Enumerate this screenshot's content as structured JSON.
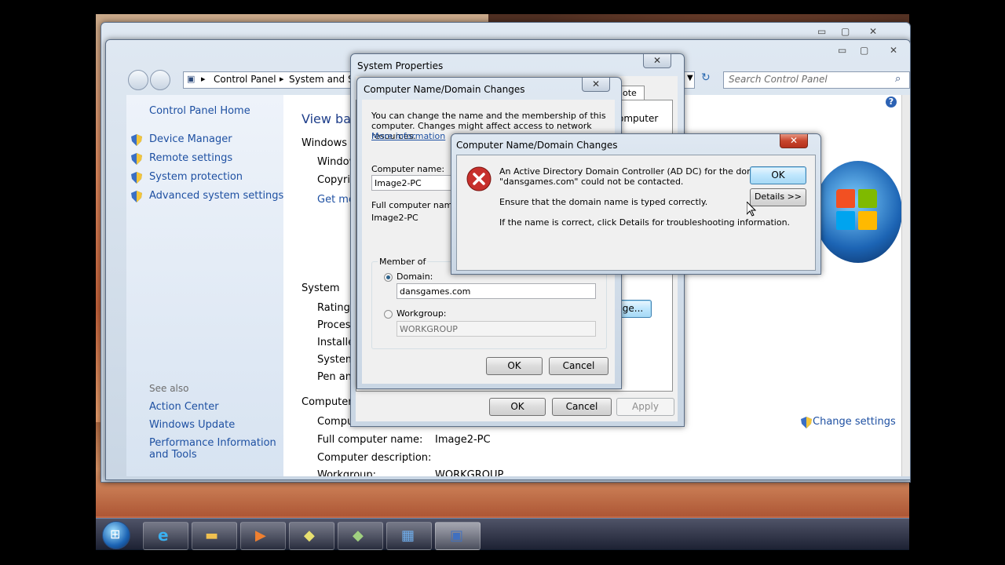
{
  "control_panel": {
    "nav": {
      "address_items": [
        "Control Panel",
        "System and Sec"
      ],
      "search_placeholder": "Search Control Panel"
    },
    "sidebar": {
      "home": "Control Panel Home",
      "items": [
        "Device Manager",
        "Remote settings",
        "System protection",
        "Advanced system settings"
      ],
      "see_also_label": "See also",
      "see_also": [
        "Action Center",
        "Windows Update",
        "Performance Information and Tools"
      ]
    },
    "main": {
      "title": "View bas",
      "windows_edition": "Windows ed",
      "edition_rows": [
        "Window",
        "Copyrig"
      ],
      "get_more": "Get mor",
      "system_label": "System",
      "system_rows": [
        "Rating:",
        "Processo",
        "Installed",
        "System t",
        "Pen and"
      ],
      "computer_section": "Computer n",
      "computer_rows": [
        {
          "label": "Comput",
          "value": ""
        },
        {
          "label": "Full computer name:",
          "value": "Image2-PC"
        },
        {
          "label": "Computer description:",
          "value": ""
        },
        {
          "label": "Workgroup:",
          "value": "WORKGROUP"
        }
      ],
      "change_settings": "Change settings"
    }
  },
  "system_properties": {
    "title": "System Properties",
    "tab_visible": "note",
    "computer_fragment": "omputer",
    "change_btn_fragment": "ge...",
    "ok": "OK",
    "cancel": "Cancel",
    "apply": "Apply"
  },
  "name_changes": {
    "title": "Computer Name/Domain Changes",
    "intro": "You can change the name and the membership of this computer. Changes might affect access to network resources.",
    "more_info": "More information",
    "computer_name_label": "Computer name:",
    "computer_name_value": "Image2-PC",
    "full_name_label": "Full computer name:",
    "full_name_value": "Image2-PC",
    "member_of": "Member of",
    "domain_label": "Domain:",
    "domain_value": "dansgames.com",
    "workgroup_label": "Workgroup:",
    "workgroup_value": "WORKGROUP",
    "ok": "OK",
    "cancel": "Cancel"
  },
  "error_dialog": {
    "title": "Computer Name/Domain Changes",
    "line1": "An Active Directory Domain Controller (AD DC) for the domain",
    "line2": "\"dansgames.com\" could not be contacted.",
    "line3": "Ensure that the domain name is typed correctly.",
    "line4": "If the name is correct, click Details for troubleshooting information.",
    "ok": "OK",
    "details": "Details >>",
    "close": "x"
  },
  "colors": {
    "accent": "#1e50a2",
    "error_red": "#c7302c",
    "window_bg": "#f0f0f0"
  }
}
